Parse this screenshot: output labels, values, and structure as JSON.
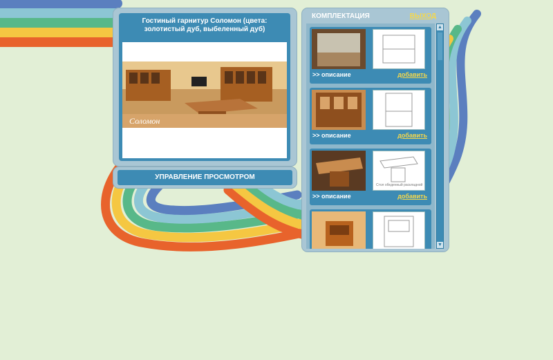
{
  "left_panel": {
    "product_title": "Гостиный гарнитур Соломон (цвета: золотистый дуб, выбеленный дуб)",
    "watermark": "Соломон"
  },
  "control": {
    "label": "УПРАВЛЕНИЕ ПРОСМОТРОМ"
  },
  "right_panel": {
    "title": "КОМПЛЕКТАЦИЯ",
    "exit_label": "ВЫХОД",
    "items": [
      {
        "desc": ">> описание",
        "add": "добавить",
        "sketch_note": ""
      },
      {
        "desc": ">> описание",
        "add": "добавить",
        "sketch_note": ""
      },
      {
        "desc": ">> описание",
        "add": "добавить",
        "sketch_note": "Стол обеденный раскладной"
      },
      {
        "desc": "",
        "add": "",
        "sketch_note": ""
      }
    ]
  },
  "colors": {
    "background": "#e2efd6",
    "panel_blue": "#3d8bb4",
    "accent_yellow": "#f6d84a",
    "rainbow": [
      "#e8632c",
      "#f5c742",
      "#58b889",
      "#8cc6d4",
      "#5b7fbf"
    ]
  }
}
